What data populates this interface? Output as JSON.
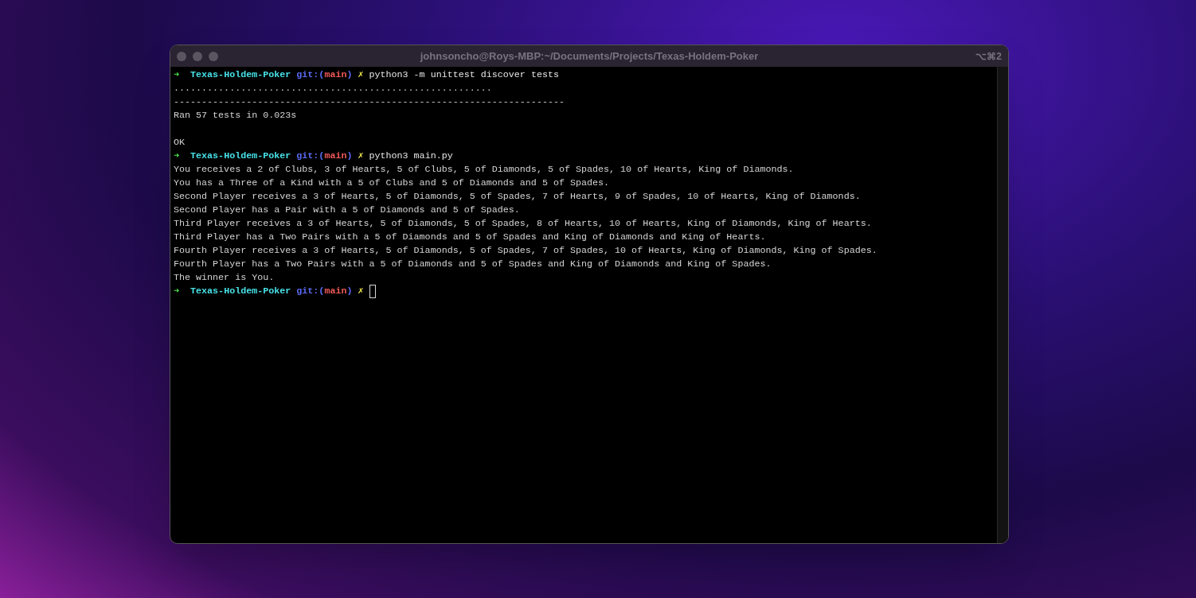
{
  "window": {
    "title": "johnsoncho@Roys-MBP:~/Documents/Projects/Texas-Holdem-Poker",
    "shortcut": "⌥⌘2"
  },
  "lines": [
    {
      "kind": "prompt",
      "arrow": "➜",
      "directory": "Texas-Holdem-Poker",
      "git_open": "git:(",
      "branch": "main",
      "git_close": ")",
      "dirty": "✗",
      "command": "python3 -m unittest discover tests",
      "cursor": false
    },
    {
      "kind": "output",
      "text": "........................................................."
    },
    {
      "kind": "output",
      "text": "----------------------------------------------------------------------"
    },
    {
      "kind": "output",
      "text": "Ran 57 tests in 0.023s"
    },
    {
      "kind": "blank"
    },
    {
      "kind": "output",
      "text": "OK"
    },
    {
      "kind": "prompt",
      "arrow": "➜",
      "directory": "Texas-Holdem-Poker",
      "git_open": "git:(",
      "branch": "main",
      "git_close": ")",
      "dirty": "✗",
      "command": "python3 main.py",
      "cursor": false
    },
    {
      "kind": "output",
      "text": "You receives a 2 of Clubs, 3 of Hearts, 5 of Clubs, 5 of Diamonds, 5 of Spades, 10 of Hearts, King of Diamonds."
    },
    {
      "kind": "output",
      "text": "You has a Three of a Kind with a 5 of Clubs and 5 of Diamonds and 5 of Spades."
    },
    {
      "kind": "output",
      "text": "Second Player receives a 3 of Hearts, 5 of Diamonds, 5 of Spades, 7 of Hearts, 9 of Spades, 10 of Hearts, King of Diamonds."
    },
    {
      "kind": "output",
      "text": "Second Player has a Pair with a 5 of Diamonds and 5 of Spades."
    },
    {
      "kind": "output",
      "text": "Third Player receives a 3 of Hearts, 5 of Diamonds, 5 of Spades, 8 of Hearts, 10 of Hearts, King of Diamonds, King of Hearts."
    },
    {
      "kind": "output",
      "text": "Third Player has a Two Pairs with a 5 of Diamonds and 5 of Spades and King of Diamonds and King of Hearts."
    },
    {
      "kind": "output",
      "text": "Fourth Player receives a 3 of Hearts, 5 of Diamonds, 5 of Spades, 7 of Spades, 10 of Hearts, King of Diamonds, King of Spades."
    },
    {
      "kind": "output",
      "text": "Fourth Player has a Two Pairs with a 5 of Diamonds and 5 of Spades and King of Diamonds and King of Spades."
    },
    {
      "kind": "output",
      "text": "The winner is You."
    },
    {
      "kind": "prompt",
      "arrow": "➜",
      "directory": "Texas-Holdem-Poker",
      "git_open": "git:(",
      "branch": "main",
      "git_close": ")",
      "dirty": "✗",
      "cursor": true
    }
  ]
}
